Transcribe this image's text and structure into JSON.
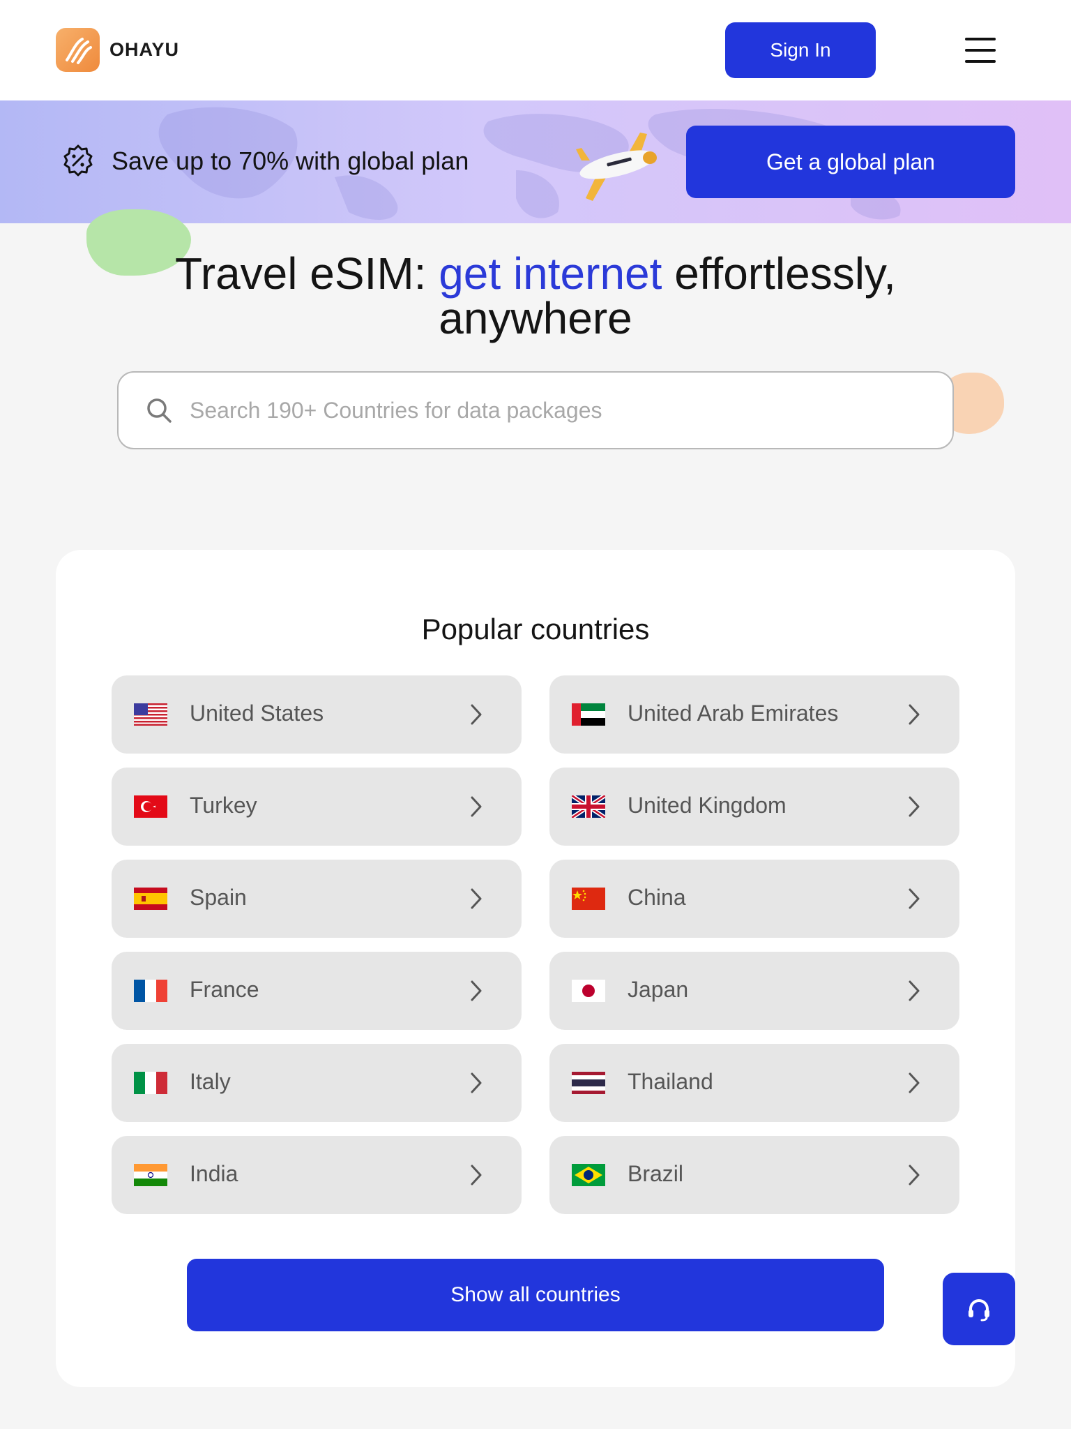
{
  "header": {
    "brand": "OHAYU",
    "sign_in_label": "Sign In"
  },
  "promo": {
    "text": "Save up to 70% with global plan",
    "cta_label": "Get a global plan"
  },
  "hero": {
    "title_part1": "Travel eSIM: ",
    "title_accent": "get internet",
    "title_part2": " effortlessly, anywhere",
    "search_placeholder": "Search 190+ Countries for data packages"
  },
  "popular": {
    "title": "Popular countries",
    "countries": [
      {
        "name": "United States",
        "flag": "us-flag"
      },
      {
        "name": "United Arab Emirates",
        "flag": "uae-flag"
      },
      {
        "name": "Turkey",
        "flag": "turkey-flag"
      },
      {
        "name": "United Kingdom",
        "flag": "uk-flag"
      },
      {
        "name": "Spain",
        "flag": "spain-flag"
      },
      {
        "name": "China",
        "flag": "china-flag"
      },
      {
        "name": "France",
        "flag": "france-flag"
      },
      {
        "name": "Japan",
        "flag": "japan-flag"
      },
      {
        "name": "Italy",
        "flag": "italy-flag"
      },
      {
        "name": "Thailand",
        "flag": "thailand-flag"
      },
      {
        "name": "India",
        "flag": "india-flag"
      },
      {
        "name": "Brazil",
        "flag": "brazil-flag"
      }
    ],
    "show_all_label": "Show all countries"
  },
  "colors": {
    "primary": "#2236dc",
    "accent_text": "#2b3ad8",
    "logo": "#ef8a3c",
    "row_bg": "#e6e6e6"
  }
}
